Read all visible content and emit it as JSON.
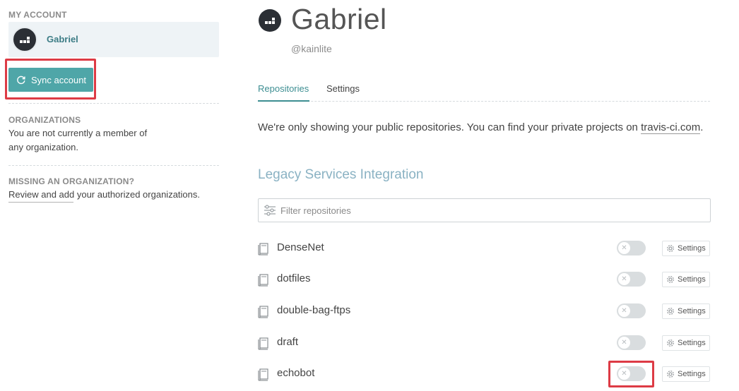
{
  "sidebar": {
    "my_account_title": "MY ACCOUNT",
    "account_name": "Gabriel",
    "sync_label": "Sync account",
    "faint_label": "",
    "organizations_title": "ORGANIZATIONS",
    "organizations_line1": "You are not currently a member of",
    "organizations_line2": "any organization.",
    "missing_title": "MISSING AN ORGANIZATION?",
    "missing_link": "Review and add your authorized organizations."
  },
  "profile": {
    "name": "Gabriel",
    "handle": "@kainlite"
  },
  "tabs": [
    {
      "label": "Repositories",
      "active": true
    },
    {
      "label": "Settings",
      "active": false
    }
  ],
  "notice": {
    "text": "We're only showing your public repositories. You can find your private projects on ",
    "link": "travis-ci.com",
    "suffix": "."
  },
  "section_heading": "Legacy Services Integration",
  "filter": {
    "placeholder": "Filter repositories"
  },
  "repositories": [
    {
      "name": "DenseNet",
      "enabled": false,
      "settings_label": "Settings"
    },
    {
      "name": "dotfiles",
      "enabled": false,
      "settings_label": "Settings"
    },
    {
      "name": "double-bag-ftps",
      "enabled": false,
      "settings_label": "Settings"
    },
    {
      "name": "draft",
      "enabled": false,
      "settings_label": "Settings"
    },
    {
      "name": "echobot",
      "enabled": false,
      "settings_label": "Settings"
    }
  ],
  "colors": {
    "accent": "#3d8e92",
    "sync_button": "#4fa6a8",
    "highlight": "#dd3b45",
    "heading": "#8ab2c3"
  },
  "icons": {
    "sync": "sync-icon",
    "filter": "filter-icon",
    "repo": "repo-book-icon",
    "gear": "gear-icon",
    "toggle_off": "x-icon"
  }
}
